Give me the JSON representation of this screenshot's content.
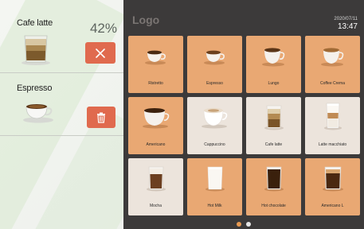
{
  "queue": {
    "items": [
      {
        "name": "Cafe latte",
        "progress_label": "42%",
        "progress": 42,
        "action": "cancel-icon"
      },
      {
        "name": "Espresso",
        "action": "trash-icon"
      }
    ]
  },
  "header": {
    "logo": "Logo",
    "date": "2020/07/11",
    "time": "13:47"
  },
  "drinks": [
    {
      "label": "Ristretto",
      "style": "orange",
      "cup": "small-cup"
    },
    {
      "label": "Espresso",
      "style": "orange",
      "cup": "small-cup"
    },
    {
      "label": "Lungo",
      "style": "orange",
      "cup": "medium-cup"
    },
    {
      "label": "Coffee Crema",
      "style": "orange",
      "cup": "medium-cup"
    },
    {
      "label": "Americano",
      "style": "orange",
      "cup": "wide-cup"
    },
    {
      "label": "Cappuccino",
      "style": "cream",
      "cup": "foam-cup"
    },
    {
      "label": "Cafe latte",
      "style": "cream",
      "cup": "glass-cup"
    },
    {
      "label": "Latte macchiato",
      "style": "cream",
      "cup": "layered-glass"
    },
    {
      "label": "Mocha",
      "style": "cream",
      "cup": "foam-cup"
    },
    {
      "label": "Hot Milk",
      "style": "orange",
      "cup": "milk-glass"
    },
    {
      "label": "Hot chocolate",
      "style": "orange",
      "cup": "dark-glass"
    },
    {
      "label": "Americano L",
      "style": "orange",
      "cup": "wide-cup"
    }
  ],
  "pagination": {
    "pages": 2,
    "current": 1
  },
  "colors": {
    "accent": "#e9a873",
    "cream": "#ece4dc",
    "panel": "#3c3a3a",
    "danger": "#e06a4e",
    "dot_active": "#e89a52"
  }
}
